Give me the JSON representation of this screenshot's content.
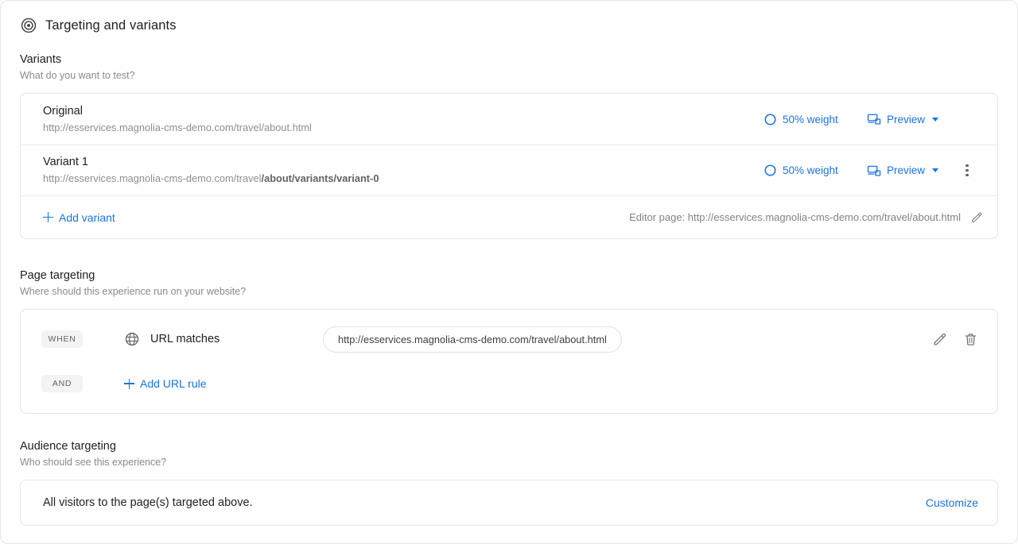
{
  "header": {
    "icon": "target-icon",
    "title": "Targeting and variants"
  },
  "variants_section": {
    "title": "Variants",
    "subtitle": "What do you want to test?",
    "rows": [
      {
        "name": "Original",
        "url_prefix": "http://esservices.magnolia-cms-demo.com/travel/about.html",
        "url_bold": "",
        "weight_label": "50% weight",
        "weight_icon": "donut-chart-icon",
        "preview_label": "Preview",
        "preview_icon": "devices-icon",
        "has_menu": false
      },
      {
        "name": "Variant 1",
        "url_prefix": "http://esservices.magnolia-cms-demo.com/travel",
        "url_bold": "/about/variants/variant-0",
        "weight_label": "50% weight",
        "weight_icon": "donut-chart-icon",
        "preview_label": "Preview",
        "preview_icon": "devices-icon",
        "has_menu": true,
        "menu_icon": "kebab-menu-icon"
      }
    ],
    "add_variant_label": "Add variant",
    "editor_page_label": "Editor page: http://esservices.magnolia-cms-demo.com/travel/about.html",
    "editor_edit_icon": "pencil-icon"
  },
  "page_targeting": {
    "title": "Page targeting",
    "subtitle": "Where should this experience run on your website?",
    "when_badge": "WHEN",
    "and_badge": "AND",
    "rule_label": "URL matches",
    "rule_icon": "globe-icon",
    "rule_value": "http://esservices.magnolia-cms-demo.com/travel/about.html",
    "edit_icon": "pencil-icon",
    "delete_icon": "trash-icon",
    "add_rule_label": "Add URL rule"
  },
  "audience_targeting": {
    "title": "Audience targeting",
    "subtitle": "Who should see this experience?",
    "description": "All visitors to the page(s) targeted above.",
    "action_label": "Customize"
  },
  "colors": {
    "accent_blue": "#1a73e8",
    "text_primary": "#202124",
    "text_secondary": "#868b90",
    "border": "#e3e5e8"
  }
}
